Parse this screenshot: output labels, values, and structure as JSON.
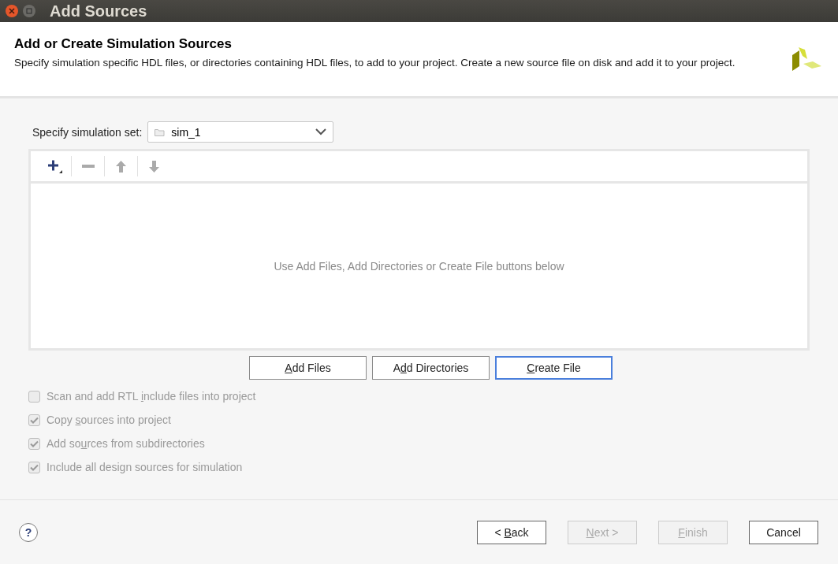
{
  "window": {
    "title": "Add Sources"
  },
  "header": {
    "title": "Add or Create Simulation Sources",
    "description": "Specify simulation specific HDL files, or directories containing HDL files, to add to your project. Create a new source file on disk and add it to your project."
  },
  "simulation_set": {
    "label": "Specify simulation set:",
    "value": "sim_1"
  },
  "toolbar": [
    {
      "kind": "add",
      "disabled": false
    },
    {
      "kind": "remove",
      "disabled": true
    },
    {
      "kind": "up",
      "disabled": true
    },
    {
      "kind": "down",
      "disabled": true
    }
  ],
  "file_list": {
    "empty_message": "Use Add Files, Add Directories or Create File buttons below"
  },
  "source_buttons": [
    {
      "key": "A",
      "post": "dd Files",
      "focused": false
    },
    {
      "pre": "A",
      "key": "d",
      "post": "d Directories",
      "focused": false
    },
    {
      "key": "C",
      "post": "reate File",
      "focused": true
    }
  ],
  "options": [
    {
      "pre": "Scan and add RTL ",
      "key": "i",
      "post": "nclude files into project",
      "checked": false,
      "disabled": true
    },
    {
      "pre": "Copy ",
      "key": "s",
      "post": "ources into project",
      "checked": true,
      "disabled": true
    },
    {
      "pre": "Add so",
      "key": "u",
      "post": "rces from subdirectories",
      "checked": true,
      "disabled": true
    },
    {
      "pre": "Include all design sources for simulation",
      "checked": true,
      "disabled": true
    }
  ],
  "help_button": {
    "label": "?"
  },
  "nav_buttons": [
    {
      "pre": "< ",
      "key": "B",
      "post": "ack",
      "disabled": false
    },
    {
      "key": "N",
      "post": "ext >",
      "disabled": true
    },
    {
      "key": "F",
      "post": "inish",
      "disabled": true
    },
    {
      "pre": "Cancel",
      "disabled": false
    }
  ]
}
